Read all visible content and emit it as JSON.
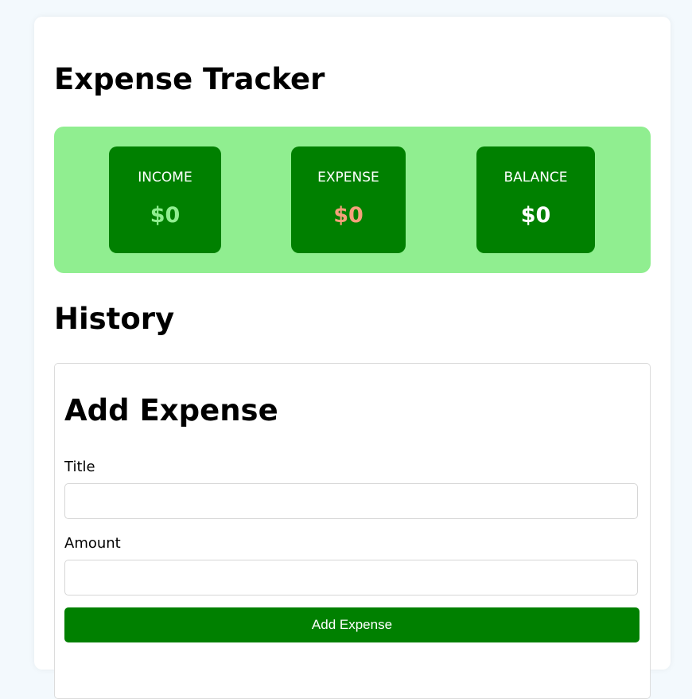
{
  "header": {
    "title": "Expense Tracker"
  },
  "summary": {
    "income": {
      "label": "INCOME",
      "value": "$0"
    },
    "expense": {
      "label": "EXPENSE",
      "value": "$0"
    },
    "balance": {
      "label": "BALANCE",
      "value": "$0"
    }
  },
  "history": {
    "title": "History"
  },
  "form": {
    "title": "Add Expense",
    "title_field": {
      "label": "Title",
      "value": "",
      "placeholder": ""
    },
    "amount_field": {
      "label": "Amount",
      "value": "",
      "placeholder": ""
    },
    "submit_label": "Add Expense"
  },
  "colors": {
    "page_background": "#f3f9fd",
    "summary_background": "#90ee90",
    "stat_card": "#008000",
    "income_value": "#90ee90",
    "expense_value": "#f4a07a",
    "balance_value": "#ffffff",
    "button": "#008000"
  }
}
